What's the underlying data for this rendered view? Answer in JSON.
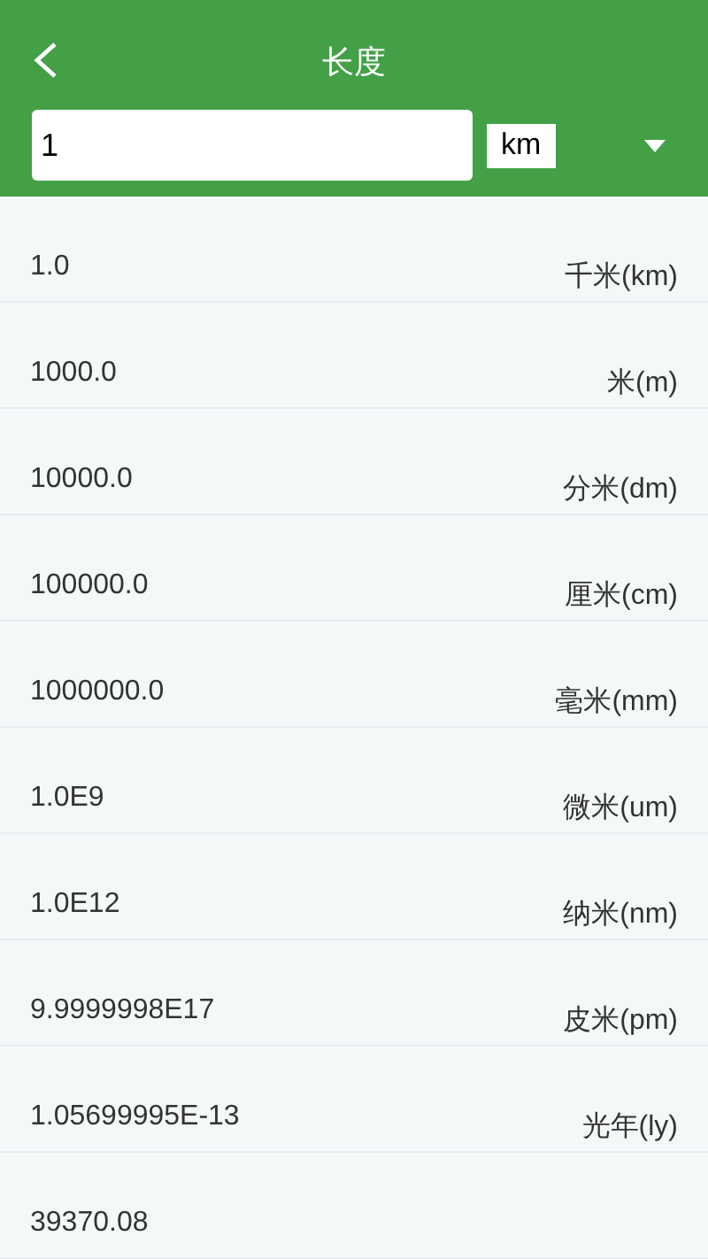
{
  "header": {
    "title": "长度"
  },
  "input": {
    "value": "1"
  },
  "unit_select": {
    "value": "km"
  },
  "results": [
    {
      "value": "1.0",
      "unit": "千米(km)"
    },
    {
      "value": "1000.0",
      "unit": "米(m)"
    },
    {
      "value": "10000.0",
      "unit": "分米(dm)"
    },
    {
      "value": "100000.0",
      "unit": "厘米(cm)"
    },
    {
      "value": "1000000.0",
      "unit": "毫米(mm)"
    },
    {
      "value": "1.0E9",
      "unit": "微米(um)"
    },
    {
      "value": "1.0E12",
      "unit": "纳米(nm)"
    },
    {
      "value": "9.9999998E17",
      "unit": "皮米(pm)"
    },
    {
      "value": "1.05699995E-13",
      "unit": "光年(ly)"
    },
    {
      "value": "39370.08"
    }
  ]
}
